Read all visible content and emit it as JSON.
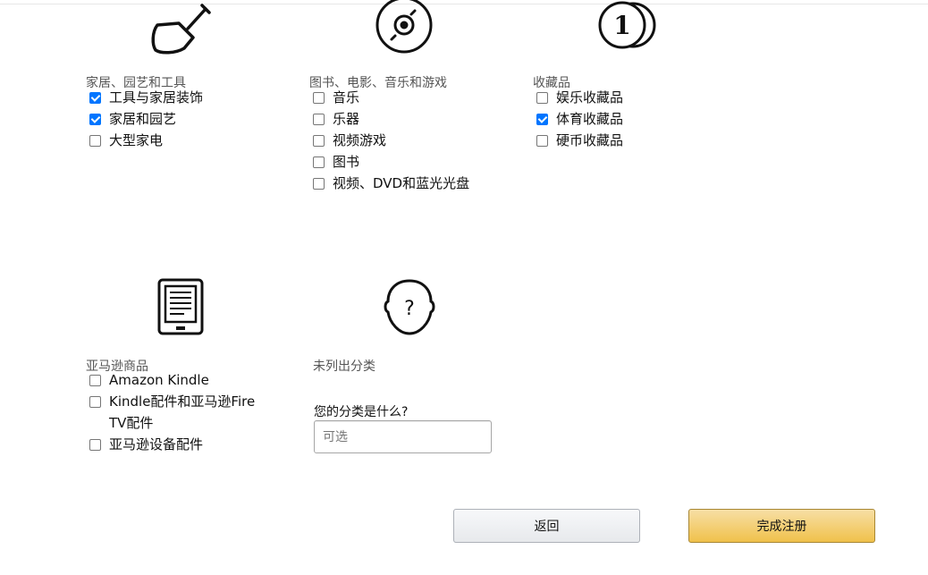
{
  "categories": [
    {
      "title": "家居、园艺和工具",
      "icon": "shovel-icon",
      "items": [
        {
          "label": "工具与家居装饰",
          "checked": true
        },
        {
          "label": "家居和园艺",
          "checked": true
        },
        {
          "label": "大型家电",
          "checked": false
        }
      ]
    },
    {
      "title": "图书、电影、音乐和游戏",
      "icon": "disc-icon",
      "items": [
        {
          "label": "音乐",
          "checked": false
        },
        {
          "label": "乐器",
          "checked": false
        },
        {
          "label": "视频游戏",
          "checked": false
        },
        {
          "label": "图书",
          "checked": false
        },
        {
          "label": "视频、DVD和蓝光光盘",
          "checked": false
        }
      ]
    },
    {
      "title": "收藏品",
      "icon": "coin-icon",
      "coin_text": "1",
      "items": [
        {
          "label": "娱乐收藏品",
          "checked": false
        },
        {
          "label": "体育收藏品",
          "checked": true
        },
        {
          "label": "硬币收藏品",
          "checked": false
        }
      ]
    },
    {
      "title": "亚马逊商品",
      "icon": "ereader-icon",
      "items": [
        {
          "label": "Amazon Kindle",
          "checked": false
        },
        {
          "label": "Kindle配件和亚马逊Fire TV配件",
          "checked": false
        },
        {
          "label": "亚马逊设备配件",
          "checked": false
        }
      ]
    }
  ],
  "unlisted": {
    "icon": "question-head-icon",
    "icon_text": "?",
    "title": "未列出分类",
    "question": "您的分类是什么?",
    "placeholder": "可选",
    "value": ""
  },
  "buttons": {
    "back_label": "返回",
    "finish_label": "完成注册"
  }
}
